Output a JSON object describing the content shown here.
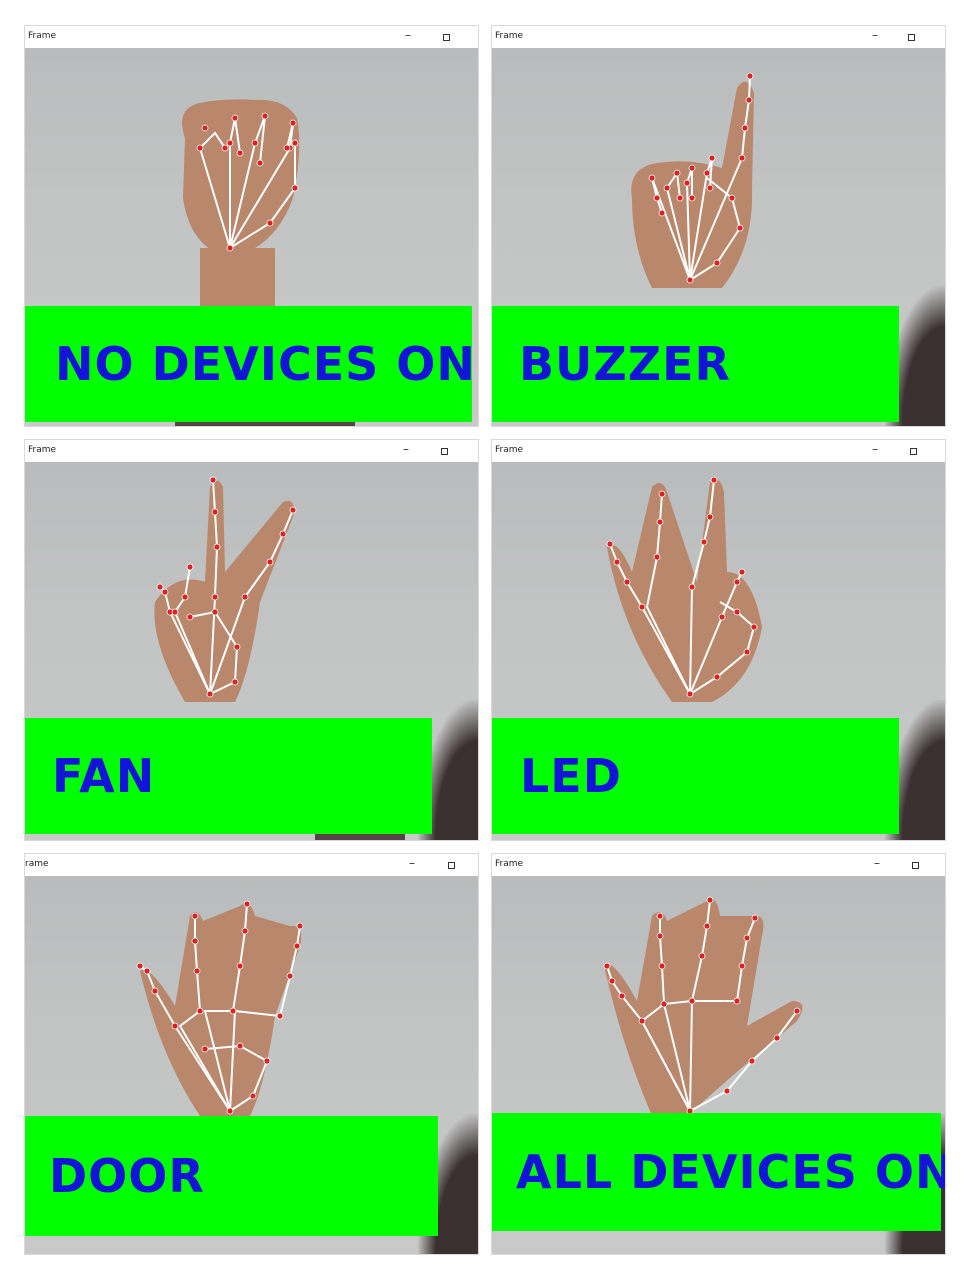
{
  "windows": [
    {
      "title": "Frame",
      "label": "NO DEVICES ON"
    },
    {
      "title": "Frame",
      "label": "BUZZER"
    },
    {
      "title": "Frame",
      "label": "FAN"
    },
    {
      "title": "Frame",
      "label": "LED"
    },
    {
      "title": "rame",
      "label": "DOOR"
    },
    {
      "title": "Frame",
      "label": "ALL DEVICES ON"
    }
  ],
  "controls": {
    "minimize_glyph": "–",
    "maximize_glyph": ""
  },
  "colors": {
    "banner": "#00ff00",
    "label_text": "#1414d8",
    "landmark": "#e02020",
    "connection": "#ffffff"
  }
}
